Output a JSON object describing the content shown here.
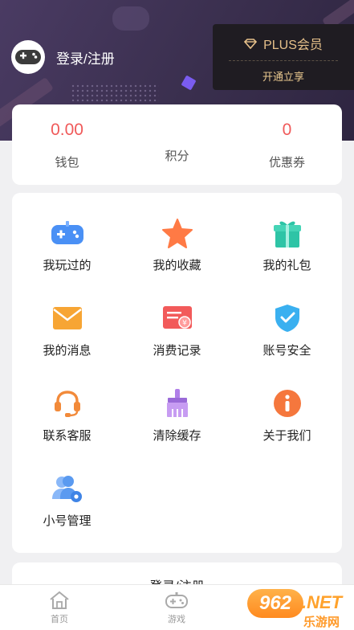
{
  "header": {
    "login_label": "登录/注册"
  },
  "plus": {
    "title": "PLUS会员",
    "action": "开通立享"
  },
  "stats": [
    {
      "value": "0.00",
      "label": "钱包"
    },
    {
      "value": "",
      "label": "积分"
    },
    {
      "value": "0",
      "label": "优惠券"
    }
  ],
  "menu": [
    {
      "label": "我玩过的",
      "icon": "gamepad-icon",
      "color": "#4a90f5"
    },
    {
      "label": "我的收藏",
      "icon": "star-icon",
      "color": "#ff7a45"
    },
    {
      "label": "我的礼包",
      "icon": "gift-icon",
      "color": "#2ec4a6"
    },
    {
      "label": "我的消息",
      "icon": "envelope-icon",
      "color": "#f7a534"
    },
    {
      "label": "消费记录",
      "icon": "receipt-icon",
      "color": "#f25a5a"
    },
    {
      "label": "账号安全",
      "icon": "shield-icon",
      "color": "#3ab0f0"
    },
    {
      "label": "联系客服",
      "icon": "headset-icon",
      "color": "#f28a3a"
    },
    {
      "label": "清除缓存",
      "icon": "brush-icon",
      "color": "#b07fe8"
    },
    {
      "label": "关于我们",
      "icon": "info-icon",
      "color": "#f5773d"
    },
    {
      "label": "小号管理",
      "icon": "users-gear-icon",
      "color": "#5a9af0"
    }
  ],
  "login_card": {
    "label": "登录/注册"
  },
  "tabs": [
    {
      "label": "首页",
      "icon": "home-icon"
    },
    {
      "label": "游戏",
      "icon": "gamepad-icon"
    }
  ],
  "watermark": {
    "brand": "962",
    "suffix": ".NET",
    "cn": "乐游网"
  }
}
